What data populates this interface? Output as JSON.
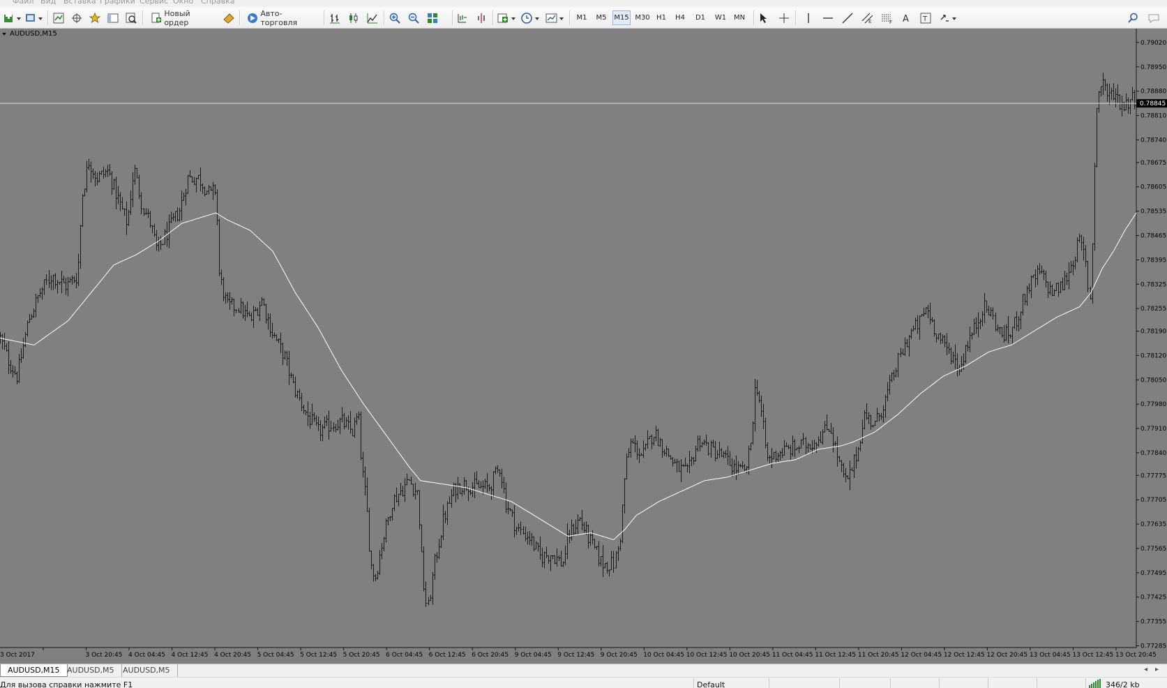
{
  "menu": [
    "Файл",
    "Вид",
    "Вставка",
    "Графики",
    "Сервис",
    "Окно",
    "Справка"
  ],
  "toolbar": {
    "new_order_label": "Новый ордер",
    "auto_trading_label": "Авто-торговля",
    "timeframes": [
      "M1",
      "M5",
      "M15",
      "M30",
      "H1",
      "H4",
      "D1",
      "W1",
      "MN"
    ],
    "active_timeframe": "M15"
  },
  "chart": {
    "symbol_label": "AUDUSD,M15",
    "background_color": "#808080",
    "bar_color": "#1a1a1a",
    "ma_color": "#ffffff",
    "current_price_label": "0.78845"
  },
  "chart_data": {
    "type": "bar",
    "symbol": "AUDUSD",
    "timeframe": "M15",
    "ylim": [
      0.7728,
      0.7906
    ],
    "y_ticks": [
      "0.79020",
      "0.78950",
      "0.78880",
      "0.78810",
      "0.78740",
      "0.78675",
      "0.78605",
      "0.78535",
      "0.78465",
      "0.78395",
      "0.78325",
      "0.78255",
      "0.78190",
      "0.78120",
      "0.78050",
      "0.77980",
      "0.77910",
      "0.77840",
      "0.77775",
      "0.77705",
      "0.77635",
      "0.77565",
      "0.77495",
      "0.77425",
      "0.77355",
      "0.77285"
    ],
    "x_ticks": [
      "3 Oct 2017",
      "3 Oct 20:45",
      "4 Oct 04:45",
      "4 Oct 12:45",
      "4 Oct 20:45",
      "5 Oct 04:45",
      "5 Oct 12:45",
      "5 Oct 20:45",
      "6 Oct 04:45",
      "6 Oct 12:45",
      "6 Oct 20:45",
      "9 Oct 04:45",
      "9 Oct 12:45",
      "9 Oct 20:45",
      "10 Oct 04:45",
      "10 Oct 12:45",
      "10 Oct 20:45",
      "11 Oct 04:45",
      "11 Oct 12:45",
      "11 Oct 20:45",
      "12 Oct 04:45",
      "12 Oct 12:45",
      "12 Oct 20:45",
      "13 Oct 04:45",
      "13 Oct 12:45",
      "13 Oct 20:45"
    ],
    "current_price": 0.78845,
    "price_keypoints": [
      [
        0,
        0.7817
      ],
      [
        0.008,
        0.781
      ],
      [
        0.015,
        0.7806
      ],
      [
        0.025,
        0.7822
      ],
      [
        0.035,
        0.783
      ],
      [
        0.045,
        0.7835
      ],
      [
        0.058,
        0.7832
      ],
      [
        0.068,
        0.7835
      ],
      [
        0.072,
        0.7858
      ],
      [
        0.078,
        0.7868
      ],
      [
        0.085,
        0.7863
      ],
      [
        0.095,
        0.7865
      ],
      [
        0.105,
        0.7856
      ],
      [
        0.112,
        0.785
      ],
      [
        0.118,
        0.7866
      ],
      [
        0.125,
        0.7855
      ],
      [
        0.132,
        0.785
      ],
      [
        0.138,
        0.7842
      ],
      [
        0.148,
        0.7848
      ],
      [
        0.158,
        0.7854
      ],
      [
        0.165,
        0.7863
      ],
      [
        0.175,
        0.7863
      ],
      [
        0.185,
        0.7858
      ],
      [
        0.19,
        0.786
      ],
      [
        0.193,
        0.7835
      ],
      [
        0.2,
        0.7826
      ],
      [
        0.21,
        0.7826
      ],
      [
        0.22,
        0.7822
      ],
      [
        0.23,
        0.7828
      ],
      [
        0.24,
        0.7818
      ],
      [
        0.25,
        0.7812
      ],
      [
        0.258,
        0.7803
      ],
      [
        0.27,
        0.7795
      ],
      [
        0.28,
        0.779
      ],
      [
        0.29,
        0.7792
      ],
      [
        0.3,
        0.7793
      ],
      [
        0.31,
        0.779
      ],
      [
        0.315,
        0.7795
      ],
      [
        0.318,
        0.778
      ],
      [
        0.322,
        0.777
      ],
      [
        0.326,
        0.7752
      ],
      [
        0.33,
        0.7748
      ],
      [
        0.336,
        0.7758
      ],
      [
        0.345,
        0.777
      ],
      [
        0.36,
        0.7776
      ],
      [
        0.368,
        0.7772
      ],
      [
        0.372,
        0.7748
      ],
      [
        0.376,
        0.7738
      ],
      [
        0.382,
        0.7752
      ],
      [
        0.39,
        0.7765
      ],
      [
        0.4,
        0.7774
      ],
      [
        0.41,
        0.7775
      ],
      [
        0.42,
        0.7774
      ],
      [
        0.43,
        0.7774
      ],
      [
        0.44,
        0.778
      ],
      [
        0.445,
        0.777
      ],
      [
        0.455,
        0.7762
      ],
      [
        0.465,
        0.776
      ],
      [
        0.475,
        0.7754
      ],
      [
        0.485,
        0.7755
      ],
      [
        0.495,
        0.7752
      ],
      [
        0.5,
        0.776
      ],
      [
        0.51,
        0.7765
      ],
      [
        0.52,
        0.7758
      ],
      [
        0.53,
        0.7752
      ],
      [
        0.54,
        0.7752
      ],
      [
        0.545,
        0.7758
      ],
      [
        0.55,
        0.778
      ],
      [
        0.555,
        0.7787
      ],
      [
        0.565,
        0.7783
      ],
      [
        0.575,
        0.779
      ],
      [
        0.585,
        0.7785
      ],
      [
        0.595,
        0.778
      ],
      [
        0.605,
        0.7778
      ],
      [
        0.615,
        0.7788
      ],
      [
        0.625,
        0.7785
      ],
      [
        0.635,
        0.7783
      ],
      [
        0.645,
        0.778
      ],
      [
        0.655,
        0.7778
      ],
      [
        0.66,
        0.7785
      ],
      [
        0.665,
        0.7805
      ],
      [
        0.67,
        0.7795
      ],
      [
        0.675,
        0.7782
      ],
      [
        0.685,
        0.7784
      ],
      [
        0.695,
        0.7785
      ],
      [
        0.705,
        0.7786
      ],
      [
        0.715,
        0.7787
      ],
      [
        0.725,
        0.779
      ],
      [
        0.73,
        0.7792
      ],
      [
        0.735,
        0.7785
      ],
      [
        0.74,
        0.7779
      ],
      [
        0.745,
        0.7775
      ],
      [
        0.75,
        0.778
      ],
      [
        0.755,
        0.7785
      ],
      [
        0.76,
        0.7795
      ],
      [
        0.77,
        0.7792
      ],
      [
        0.78,
        0.78
      ],
      [
        0.79,
        0.781
      ],
      [
        0.8,
        0.7818
      ],
      [
        0.81,
        0.7822
      ],
      [
        0.815,
        0.7826
      ],
      [
        0.822,
        0.782
      ],
      [
        0.83,
        0.7815
      ],
      [
        0.838,
        0.7812
      ],
      [
        0.845,
        0.7808
      ],
      [
        0.85,
        0.7815
      ],
      [
        0.858,
        0.782
      ],
      [
        0.865,
        0.7826
      ],
      [
        0.872,
        0.7824
      ],
      [
        0.88,
        0.7818
      ],
      [
        0.888,
        0.7818
      ],
      [
        0.895,
        0.7823
      ],
      [
        0.905,
        0.7832
      ],
      [
        0.915,
        0.7836
      ],
      [
        0.925,
        0.783
      ],
      [
        0.935,
        0.7832
      ],
      [
        0.945,
        0.784
      ],
      [
        0.95,
        0.7845
      ],
      [
        0.955,
        0.784
      ],
      [
        0.958,
        0.783
      ],
      [
        0.96,
        0.7828
      ],
      [
        0.962,
        0.786
      ],
      [
        0.965,
        0.7885
      ],
      [
        0.97,
        0.7892
      ],
      [
        0.975,
        0.7886
      ],
      [
        0.98,
        0.7888
      ],
      [
        0.985,
        0.7885
      ],
      [
        0.99,
        0.7884
      ],
      [
        0.995,
        0.7886
      ],
      [
        1,
        0.7886
      ]
    ],
    "ma_keypoints": [
      [
        0,
        0.7817
      ],
      [
        0.015,
        0.7816
      ],
      [
        0.03,
        0.7815
      ],
      [
        0.06,
        0.7822
      ],
      [
        0.08,
        0.783
      ],
      [
        0.1,
        0.7838
      ],
      [
        0.12,
        0.7841
      ],
      [
        0.14,
        0.7845
      ],
      [
        0.16,
        0.785
      ],
      [
        0.18,
        0.7852
      ],
      [
        0.19,
        0.7853
      ],
      [
        0.2,
        0.7851
      ],
      [
        0.22,
        0.7848
      ],
      [
        0.24,
        0.7842
      ],
      [
        0.26,
        0.783
      ],
      [
        0.28,
        0.782
      ],
      [
        0.3,
        0.7808
      ],
      [
        0.32,
        0.7798
      ],
      [
        0.34,
        0.7789
      ],
      [
        0.36,
        0.778
      ],
      [
        0.37,
        0.7776
      ],
      [
        0.39,
        0.7775
      ],
      [
        0.41,
        0.7774
      ],
      [
        0.43,
        0.7772
      ],
      [
        0.45,
        0.777
      ],
      [
        0.47,
        0.7766
      ],
      [
        0.49,
        0.7762
      ],
      [
        0.5,
        0.776
      ],
      [
        0.52,
        0.7761
      ],
      [
        0.54,
        0.7759
      ],
      [
        0.55,
        0.7762
      ],
      [
        0.56,
        0.7766
      ],
      [
        0.58,
        0.777
      ],
      [
        0.6,
        0.7773
      ],
      [
        0.62,
        0.7776
      ],
      [
        0.64,
        0.7777
      ],
      [
        0.66,
        0.7779
      ],
      [
        0.68,
        0.7781
      ],
      [
        0.7,
        0.7782
      ],
      [
        0.72,
        0.7785
      ],
      [
        0.74,
        0.7786
      ],
      [
        0.75,
        0.7787
      ],
      [
        0.77,
        0.779
      ],
      [
        0.79,
        0.7795
      ],
      [
        0.81,
        0.7801
      ],
      [
        0.83,
        0.7806
      ],
      [
        0.85,
        0.7809
      ],
      [
        0.87,
        0.7813
      ],
      [
        0.89,
        0.7815
      ],
      [
        0.91,
        0.7819
      ],
      [
        0.93,
        0.7823
      ],
      [
        0.95,
        0.7826
      ],
      [
        0.96,
        0.783
      ],
      [
        0.97,
        0.7837
      ],
      [
        0.98,
        0.7842
      ],
      [
        0.99,
        0.7848
      ],
      [
        1,
        0.7853
      ]
    ]
  },
  "tabs": [
    "AUDUSD,M15",
    "AUDUSD,M5",
    "AUDUSD,M5"
  ],
  "status": {
    "help_text": "Для вызова справки нажмите F1",
    "profile": "Default",
    "traffic": "346/2 kb"
  }
}
